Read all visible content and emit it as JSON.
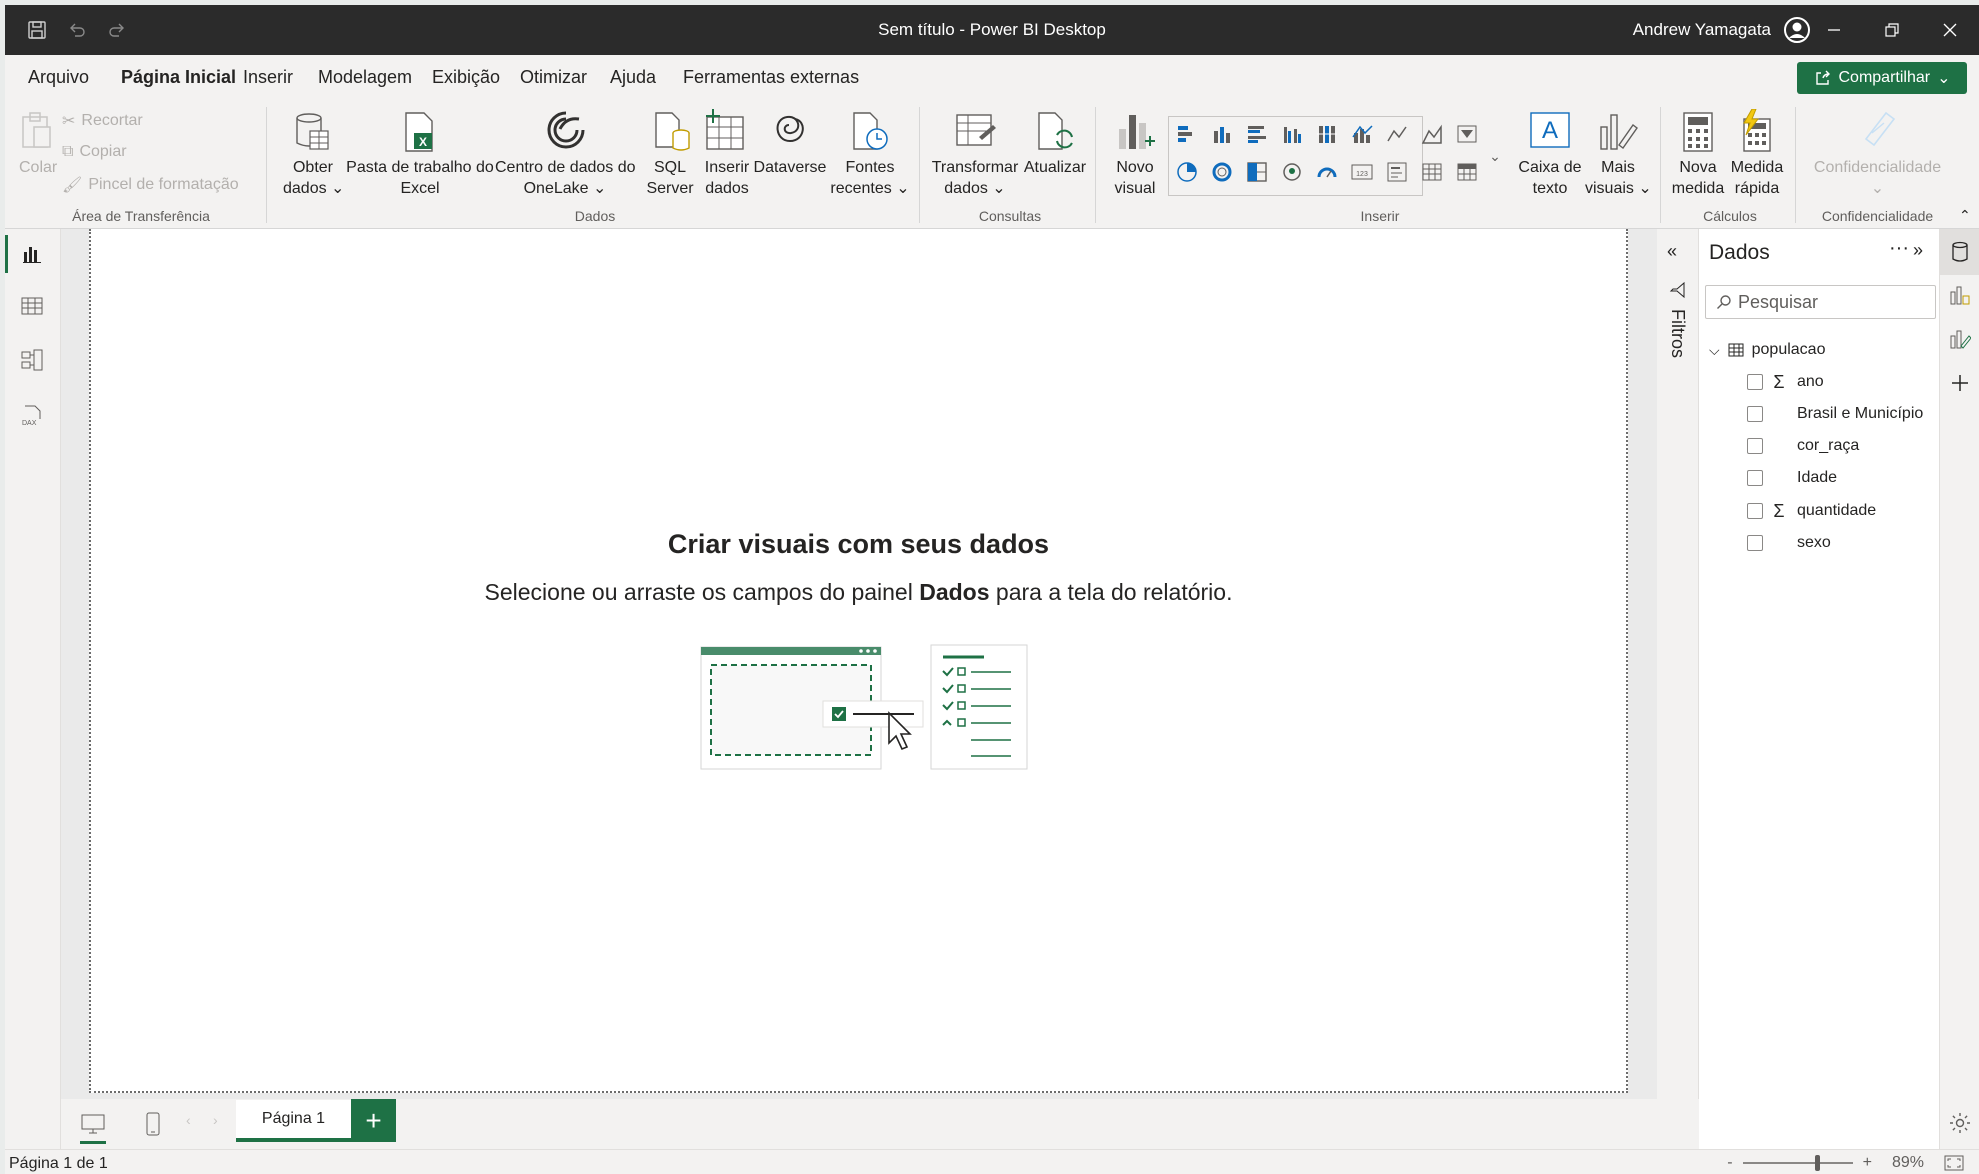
{
  "window": {
    "title": "Sem título - Power BI Desktop",
    "user": "Andrew Yamagata"
  },
  "menu": {
    "tabs": [
      "Arquivo",
      "Página Inicial",
      "Inserir",
      "Modelagem",
      "Exibição",
      "Otimizar",
      "Ajuda",
      "Ferramentas externas"
    ],
    "active": "Página Inicial",
    "share_label": "Compartilhar"
  },
  "ribbon": {
    "clipboard": {
      "paste": "Colar",
      "cut": "Recortar",
      "copy": "Copiar",
      "format_painter": "Pincel de formatação",
      "group": "Área de Transferência"
    },
    "data": {
      "get_data_1": "Obter",
      "get_data_2": "dados",
      "excel_1": "Pasta de trabalho do",
      "excel_2": "Excel",
      "onelake_1": "Centro de dados do",
      "onelake_2": "OneLake",
      "sql_1": "SQL",
      "sql_2": "Server",
      "enter_1": "Inserir",
      "enter_2": "dados",
      "dataverse": "Dataverse",
      "recent_1": "Fontes",
      "recent_2": "recentes",
      "group": "Dados"
    },
    "queries": {
      "transform_1": "Transformar",
      "transform_2": "dados",
      "refresh": "Atualizar",
      "group": "Consultas"
    },
    "insert": {
      "new_visual_1": "Novo",
      "new_visual_2": "visual",
      "textbox_1": "Caixa de",
      "textbox_2": "texto",
      "more_1": "Mais",
      "more_2": "visuais",
      "group": "Inserir"
    },
    "calculations": {
      "new_measure_1": "Nova",
      "new_measure_2": "medida",
      "quick_measure_1": "Medida",
      "quick_measure_2": "rápida",
      "group": "Cálculos"
    },
    "sensitivity": {
      "label": "Confidencialidade",
      "group": "Confidencialidade"
    }
  },
  "canvas": {
    "empty_title": "Criar visuais com seus dados",
    "empty_sub_before": "Selecione ou arraste os campos do painel ",
    "empty_sub_bold": "Dados",
    "empty_sub_after": " para a tela do relatório."
  },
  "filters": {
    "label": "Filtros"
  },
  "data_pane": {
    "title": "Dados",
    "more": "···",
    "search_placeholder": "Pesquisar",
    "table": "populacao",
    "fields": [
      {
        "name": "ano",
        "sigma": "Σ"
      },
      {
        "name": "Brasil e Município",
        "sigma": ""
      },
      {
        "name": "cor_raça",
        "sigma": ""
      },
      {
        "name": "Idade",
        "sigma": ""
      },
      {
        "name": "quantidade",
        "sigma": "Σ"
      },
      {
        "name": "sexo",
        "sigma": ""
      }
    ]
  },
  "pages": {
    "tabs": [
      "Página 1"
    ],
    "add": "+"
  },
  "status": {
    "page_info": "Página 1 de 1",
    "zoom_minus": "-",
    "zoom_plus": "+",
    "zoom": "89%"
  },
  "colors": {
    "accent": "#1e7145",
    "titlebar": "#2b2b2b"
  }
}
